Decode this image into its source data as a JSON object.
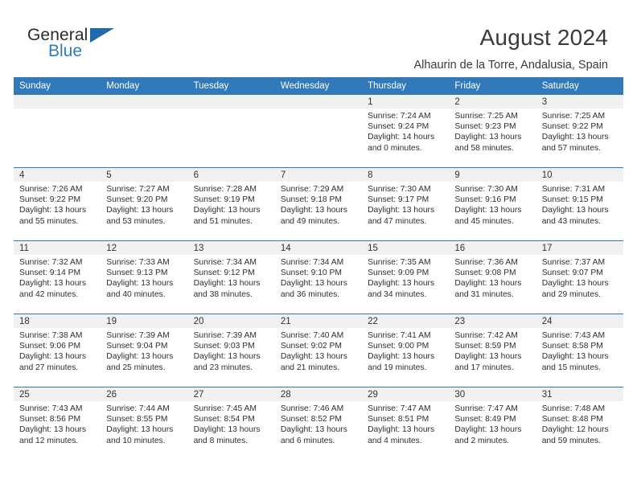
{
  "brand": {
    "name_top": "General",
    "name_bottom": "Blue",
    "triangle_color": "#1e6bb0",
    "blue_color": "#2b7cc4"
  },
  "header": {
    "title": "August 2024",
    "subtitle": "Alhaurin de la Torre, Andalusia, Spain"
  },
  "theme": {
    "header_blue": "#3279ba",
    "daynum_band": "#f1f1f1"
  },
  "weekdays": [
    "Sunday",
    "Monday",
    "Tuesday",
    "Wednesday",
    "Thursday",
    "Friday",
    "Saturday"
  ],
  "labels": {
    "sunrise_prefix": "Sunrise:",
    "sunset_prefix": "Sunset:",
    "daylight_prefix": "Daylight:"
  },
  "weeks": [
    [
      {
        "day": "",
        "empty": true
      },
      {
        "day": "",
        "empty": true
      },
      {
        "day": "",
        "empty": true
      },
      {
        "day": "",
        "empty": true
      },
      {
        "day": "1",
        "sunrise": "Sunrise: 7:24 AM",
        "sunset": "Sunset: 9:24 PM",
        "daylight": "Daylight: 14 hours and 0 minutes."
      },
      {
        "day": "2",
        "sunrise": "Sunrise: 7:25 AM",
        "sunset": "Sunset: 9:23 PM",
        "daylight": "Daylight: 13 hours and 58 minutes."
      },
      {
        "day": "3",
        "sunrise": "Sunrise: 7:25 AM",
        "sunset": "Sunset: 9:22 PM",
        "daylight": "Daylight: 13 hours and 57 minutes."
      }
    ],
    [
      {
        "day": "4",
        "sunrise": "Sunrise: 7:26 AM",
        "sunset": "Sunset: 9:22 PM",
        "daylight": "Daylight: 13 hours and 55 minutes."
      },
      {
        "day": "5",
        "sunrise": "Sunrise: 7:27 AM",
        "sunset": "Sunset: 9:20 PM",
        "daylight": "Daylight: 13 hours and 53 minutes."
      },
      {
        "day": "6",
        "sunrise": "Sunrise: 7:28 AM",
        "sunset": "Sunset: 9:19 PM",
        "daylight": "Daylight: 13 hours and 51 minutes."
      },
      {
        "day": "7",
        "sunrise": "Sunrise: 7:29 AM",
        "sunset": "Sunset: 9:18 PM",
        "daylight": "Daylight: 13 hours and 49 minutes."
      },
      {
        "day": "8",
        "sunrise": "Sunrise: 7:30 AM",
        "sunset": "Sunset: 9:17 PM",
        "daylight": "Daylight: 13 hours and 47 minutes."
      },
      {
        "day": "9",
        "sunrise": "Sunrise: 7:30 AM",
        "sunset": "Sunset: 9:16 PM",
        "daylight": "Daylight: 13 hours and 45 minutes."
      },
      {
        "day": "10",
        "sunrise": "Sunrise: 7:31 AM",
        "sunset": "Sunset: 9:15 PM",
        "daylight": "Daylight: 13 hours and 43 minutes."
      }
    ],
    [
      {
        "day": "11",
        "sunrise": "Sunrise: 7:32 AM",
        "sunset": "Sunset: 9:14 PM",
        "daylight": "Daylight: 13 hours and 42 minutes."
      },
      {
        "day": "12",
        "sunrise": "Sunrise: 7:33 AM",
        "sunset": "Sunset: 9:13 PM",
        "daylight": "Daylight: 13 hours and 40 minutes."
      },
      {
        "day": "13",
        "sunrise": "Sunrise: 7:34 AM",
        "sunset": "Sunset: 9:12 PM",
        "daylight": "Daylight: 13 hours and 38 minutes."
      },
      {
        "day": "14",
        "sunrise": "Sunrise: 7:34 AM",
        "sunset": "Sunset: 9:10 PM",
        "daylight": "Daylight: 13 hours and 36 minutes."
      },
      {
        "day": "15",
        "sunrise": "Sunrise: 7:35 AM",
        "sunset": "Sunset: 9:09 PM",
        "daylight": "Daylight: 13 hours and 34 minutes."
      },
      {
        "day": "16",
        "sunrise": "Sunrise: 7:36 AM",
        "sunset": "Sunset: 9:08 PM",
        "daylight": "Daylight: 13 hours and 31 minutes."
      },
      {
        "day": "17",
        "sunrise": "Sunrise: 7:37 AM",
        "sunset": "Sunset: 9:07 PM",
        "daylight": "Daylight: 13 hours and 29 minutes."
      }
    ],
    [
      {
        "day": "18",
        "sunrise": "Sunrise: 7:38 AM",
        "sunset": "Sunset: 9:06 PM",
        "daylight": "Daylight: 13 hours and 27 minutes."
      },
      {
        "day": "19",
        "sunrise": "Sunrise: 7:39 AM",
        "sunset": "Sunset: 9:04 PM",
        "daylight": "Daylight: 13 hours and 25 minutes."
      },
      {
        "day": "20",
        "sunrise": "Sunrise: 7:39 AM",
        "sunset": "Sunset: 9:03 PM",
        "daylight": "Daylight: 13 hours and 23 minutes."
      },
      {
        "day": "21",
        "sunrise": "Sunrise: 7:40 AM",
        "sunset": "Sunset: 9:02 PM",
        "daylight": "Daylight: 13 hours and 21 minutes."
      },
      {
        "day": "22",
        "sunrise": "Sunrise: 7:41 AM",
        "sunset": "Sunset: 9:00 PM",
        "daylight": "Daylight: 13 hours and 19 minutes."
      },
      {
        "day": "23",
        "sunrise": "Sunrise: 7:42 AM",
        "sunset": "Sunset: 8:59 PM",
        "daylight": "Daylight: 13 hours and 17 minutes."
      },
      {
        "day": "24",
        "sunrise": "Sunrise: 7:43 AM",
        "sunset": "Sunset: 8:58 PM",
        "daylight": "Daylight: 13 hours and 15 minutes."
      }
    ],
    [
      {
        "day": "25",
        "sunrise": "Sunrise: 7:43 AM",
        "sunset": "Sunset: 8:56 PM",
        "daylight": "Daylight: 13 hours and 12 minutes."
      },
      {
        "day": "26",
        "sunrise": "Sunrise: 7:44 AM",
        "sunset": "Sunset: 8:55 PM",
        "daylight": "Daylight: 13 hours and 10 minutes."
      },
      {
        "day": "27",
        "sunrise": "Sunrise: 7:45 AM",
        "sunset": "Sunset: 8:54 PM",
        "daylight": "Daylight: 13 hours and 8 minutes."
      },
      {
        "day": "28",
        "sunrise": "Sunrise: 7:46 AM",
        "sunset": "Sunset: 8:52 PM",
        "daylight": "Daylight: 13 hours and 6 minutes."
      },
      {
        "day": "29",
        "sunrise": "Sunrise: 7:47 AM",
        "sunset": "Sunset: 8:51 PM",
        "daylight": "Daylight: 13 hours and 4 minutes."
      },
      {
        "day": "30",
        "sunrise": "Sunrise: 7:47 AM",
        "sunset": "Sunset: 8:49 PM",
        "daylight": "Daylight: 13 hours and 2 minutes."
      },
      {
        "day": "31",
        "sunrise": "Sunrise: 7:48 AM",
        "sunset": "Sunset: 8:48 PM",
        "daylight": "Daylight: 12 hours and 59 minutes."
      }
    ]
  ]
}
